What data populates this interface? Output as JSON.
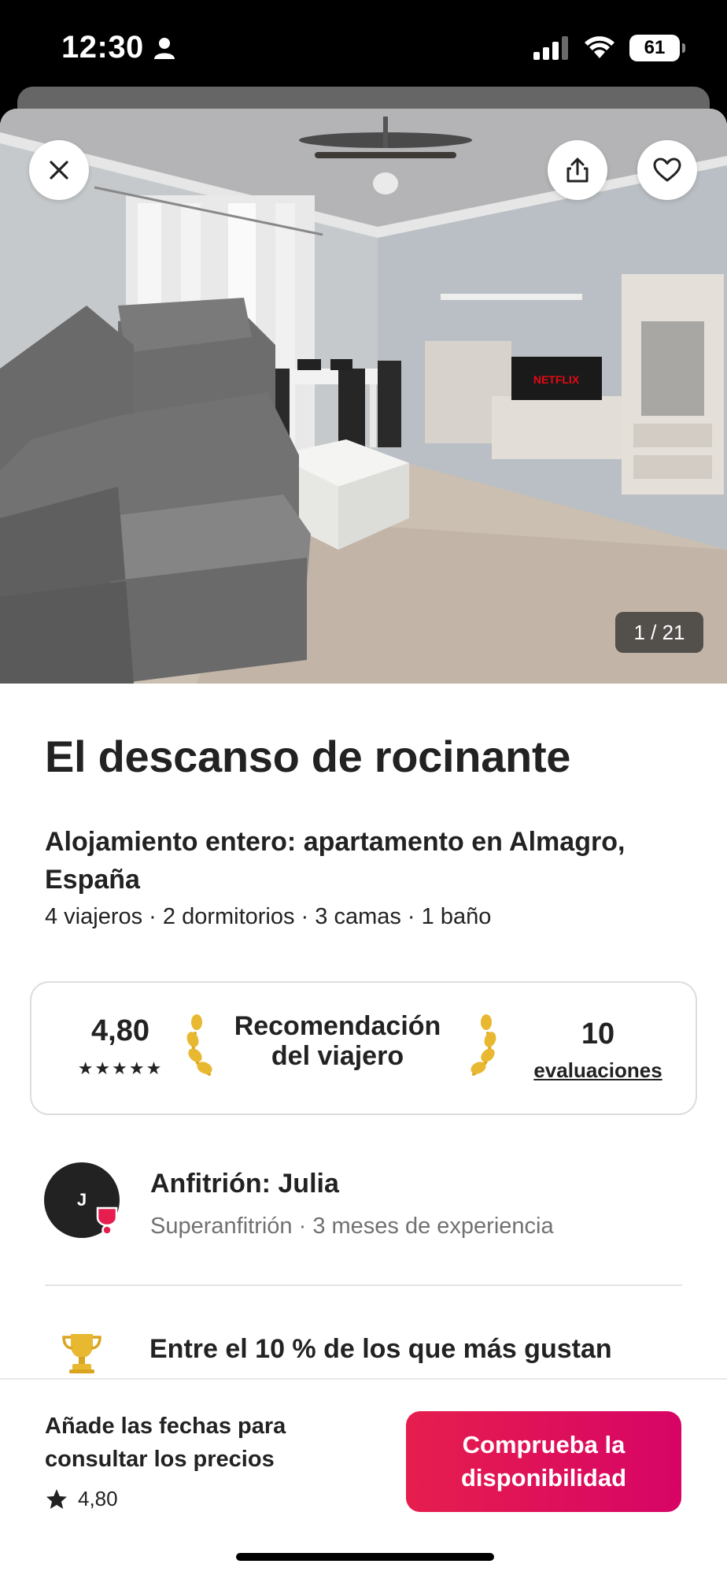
{
  "status_bar": {
    "time": "12:30",
    "battery": "61",
    "icons": [
      "person-icon",
      "cellular-signal-icon",
      "wifi-icon",
      "battery-icon"
    ]
  },
  "photo": {
    "counter": "1 / 21",
    "tv_text": "NETFLIX",
    "icons": [
      "close-icon",
      "share-icon",
      "heart-icon"
    ]
  },
  "listing": {
    "title": "El descanso de rocinante",
    "subtitle": "Alojamiento entero: apartamento en Almagro, España",
    "details": "4 viajeros · 2 dormitorios · 3 camas · 1 baño"
  },
  "rating_card": {
    "score": "4,80",
    "stars": "★★★★★",
    "badge_line1": "Recomendación",
    "badge_line2": "del viajero",
    "reviews_count": "10",
    "reviews_label": "evaluaciones"
  },
  "host": {
    "initial": "J",
    "name": "Anfitrión: Julia",
    "subtitle": "Superanfitrión · 3 meses de experiencia"
  },
  "highlight": {
    "icon": "trophy-icon",
    "text": "Entre el 10 % de los que más gustan"
  },
  "footer": {
    "prompt_line1": "Añade las fechas para",
    "prompt_line2": "consultar los precios",
    "rating": "4,80",
    "cta_line1": "Comprueba la",
    "cta_line2": "disponibilidad"
  },
  "colors": {
    "accent": "#E61E4D",
    "text": "#222222",
    "muted": "#717171",
    "laurel": "#E8B830"
  }
}
